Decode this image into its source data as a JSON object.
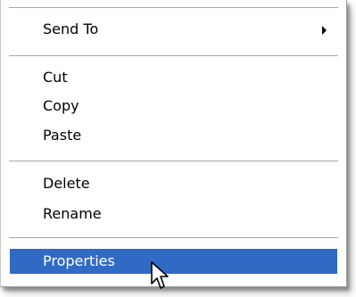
{
  "context_menu": {
    "items": [
      {
        "label": "Send To",
        "has_submenu": true
      },
      {
        "label": "Cut"
      },
      {
        "label": "Copy"
      },
      {
        "label": "Paste"
      },
      {
        "label": "Delete"
      },
      {
        "label": "Rename"
      },
      {
        "label": "Properties",
        "selected": true
      }
    ]
  },
  "colors": {
    "menu_background": "#ffffff",
    "selection_background": "#316ac5",
    "selection_text": "#ffffff",
    "separator": "#a7a6aa",
    "text": "#000000"
  },
  "icons": {
    "submenu": "submenu-arrow-icon",
    "pointer": "mouse-pointer-icon"
  }
}
